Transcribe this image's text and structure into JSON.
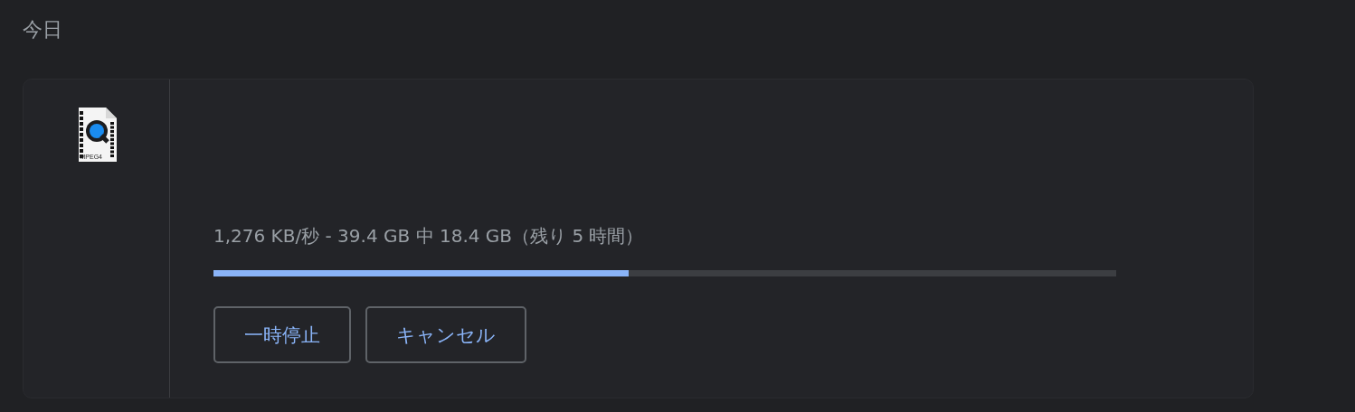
{
  "section_title": "今日",
  "download": {
    "file_icon_label": "MPEG4",
    "status": "1,276 KB/秒 - 39.4 GB 中 18.4 GB（残り 5 時間）",
    "level": 0.46,
    "buttons": [
      "一時停止",
      "キャンセル"
    ]
  }
}
